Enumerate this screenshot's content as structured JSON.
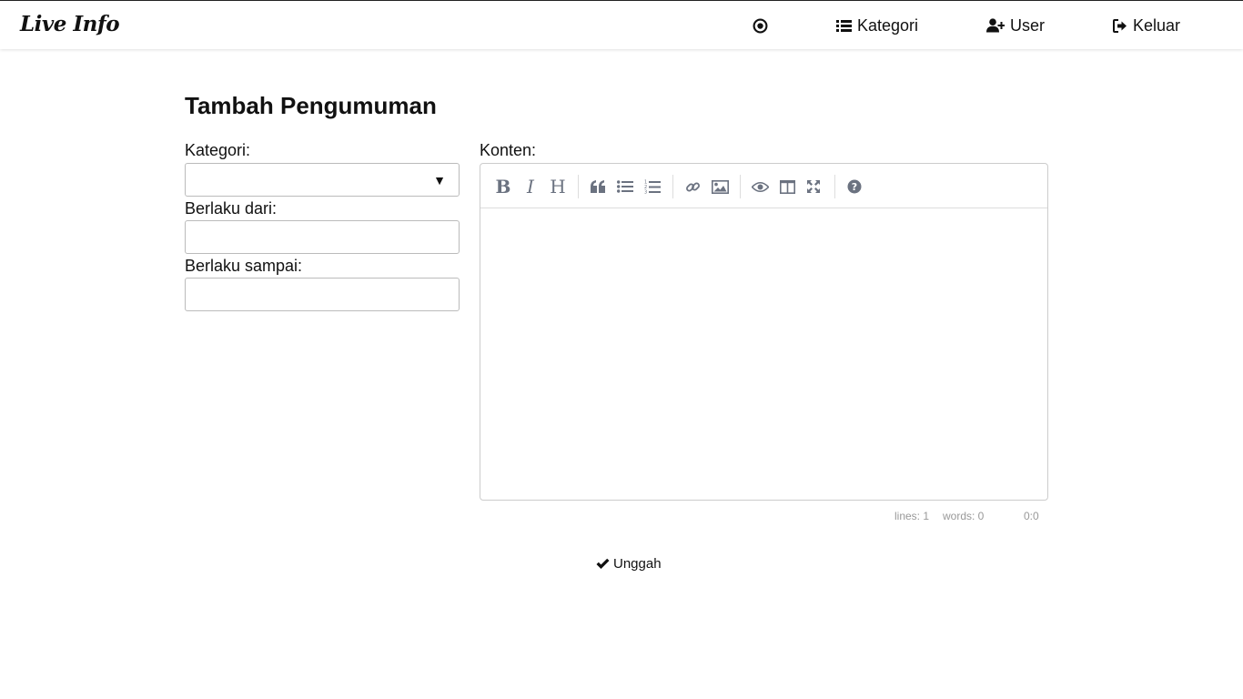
{
  "navbar": {
    "brand": "Live Info",
    "items": [
      {
        "icon": "live-circle-icon",
        "label": ""
      },
      {
        "icon": "list-icon",
        "label": "Kategori"
      },
      {
        "icon": "user-plus-icon",
        "label": "User"
      },
      {
        "icon": "sign-out-icon",
        "label": "Keluar"
      }
    ]
  },
  "page": {
    "title": "Tambah Pengumuman"
  },
  "form": {
    "kategori_label": "Kategori:",
    "kategori_value": "",
    "berlaku_dari_label": "Berlaku dari:",
    "berlaku_dari_value": "",
    "berlaku_sampai_label": "Berlaku sampai:",
    "berlaku_sampai_value": "",
    "konten_label": "Konten:"
  },
  "editor": {
    "toolbar": [
      "bold-icon",
      "italic-icon",
      "heading-icon",
      "quote-icon",
      "unordered-list-icon",
      "ordered-list-icon",
      "link-icon",
      "image-icon",
      "preview-icon",
      "side-by-side-icon",
      "fullscreen-icon",
      "help-icon"
    ],
    "content": "",
    "status": {
      "lines": "lines: 1",
      "words": "words: 0",
      "cursor": "0:0"
    }
  },
  "submit": {
    "label": "Unggah",
    "icon": "check-icon"
  },
  "colors": {
    "toolbar_icon": "#6b7280",
    "border": "#cccccc"
  }
}
